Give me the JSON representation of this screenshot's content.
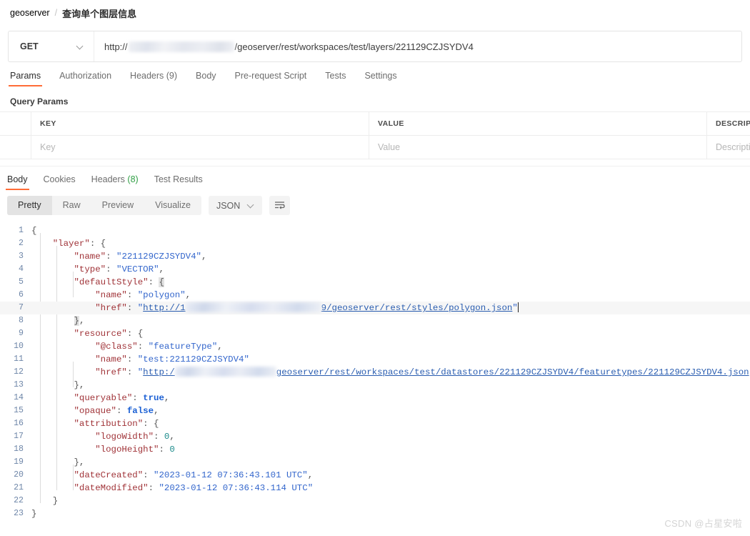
{
  "breadcrumb": {
    "root": "geoserver",
    "separator": "/",
    "current": "查询单个图层信息"
  },
  "request": {
    "method": "GET",
    "url_prefix": "http://",
    "url_suffix": "/geoserver/rest/workspaces/test/layers/221129CZJSYDV4",
    "url_redacted": true,
    "tabs": [
      {
        "label": "Params",
        "active": true
      },
      {
        "label": "Authorization",
        "active": false
      },
      {
        "label": "Headers (9)",
        "active": false
      },
      {
        "label": "Body",
        "active": false
      },
      {
        "label": "Pre-request Script",
        "active": false
      },
      {
        "label": "Tests",
        "active": false
      },
      {
        "label": "Settings",
        "active": false
      }
    ],
    "params_section_title": "Query Params",
    "params_table": {
      "headers": [
        "KEY",
        "VALUE",
        "DESCRIPTION"
      ],
      "rows": [
        {
          "key": "Key",
          "value": "Value",
          "description": "Description"
        }
      ]
    }
  },
  "response": {
    "tabs": [
      {
        "label": "Body",
        "active": true
      },
      {
        "label": "Cookies",
        "active": false
      },
      {
        "label": "Headers",
        "count": "(8)",
        "active": false
      },
      {
        "label": "Test Results",
        "active": false
      }
    ],
    "view_modes": [
      {
        "label": "Pretty",
        "active": true
      },
      {
        "label": "Raw",
        "active": false
      },
      {
        "label": "Preview",
        "active": false
      },
      {
        "label": "Visualize",
        "active": false
      }
    ],
    "format": "JSON",
    "wrap_button": "wrap-lines-icon",
    "body_json": {
      "layer": {
        "name": "221129CZJSYDV4",
        "type": "VECTOR",
        "defaultStyle": {
          "name": "polygon",
          "href_prefix": "http://1",
          "href_suffix": "9/geoserver/rest/styles/polygon.json"
        },
        "resource": {
          "@class": "featureType",
          "name": "test:221129CZJSYDV4",
          "href_prefix": "http:/",
          "href_suffix": "geoserver/rest/workspaces/test/datastores/221129CZJSYDV4/featuretypes/221129CZJSYDV4.json"
        },
        "queryable": "true",
        "opaque": "false",
        "attribution": {
          "logoWidth": "0",
          "logoHeight": "0"
        },
        "dateCreated": "2023-01-12 07:36:43.101 UTC",
        "dateModified": "2023-01-12 07:36:43.114 UTC"
      }
    },
    "line_count": 23,
    "active_line": 7
  },
  "watermark": "CSDN @占星安啦",
  "colors": {
    "accent": "#ff6c37",
    "json_key": "#a03338",
    "json_string": "#3366cc",
    "json_boolean": "#1a5fd4",
    "json_number": "#1a8a8a",
    "line_number": "#6e86a8",
    "success_green": "#2f9e44"
  }
}
